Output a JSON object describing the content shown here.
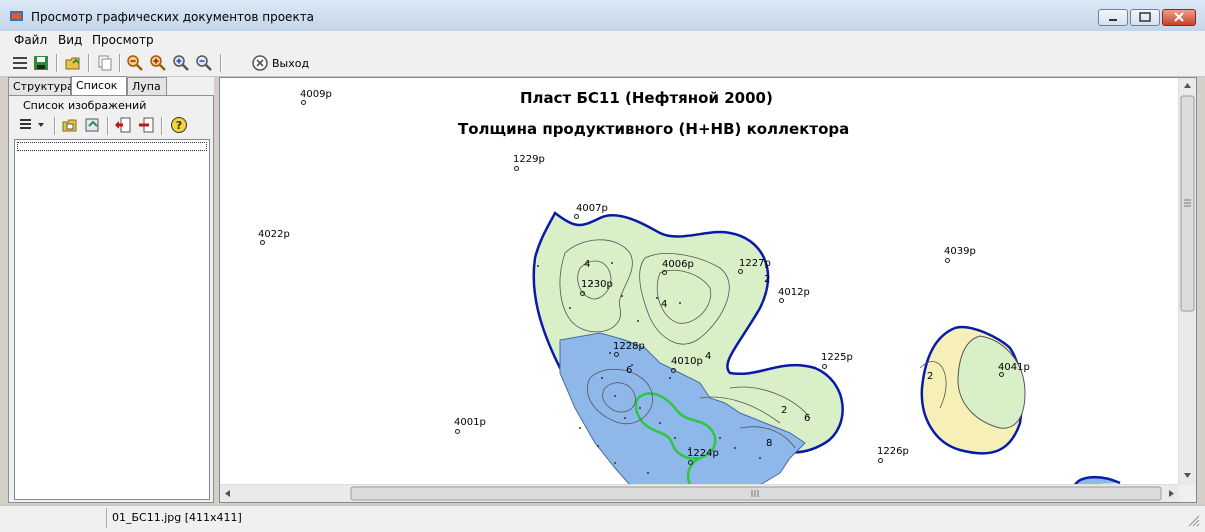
{
  "window": {
    "title": "Просмотр графических документов проекта"
  },
  "menu": {
    "items": [
      "Файл",
      "Вид",
      "Просмотр"
    ]
  },
  "toolbar": {
    "exit_label": "Выход",
    "icons": [
      "list-view-icon",
      "save-icon",
      "open-folder-icon",
      "copy-icon",
      "zoom-in-icon",
      "zoom-out-icon",
      "zoom-plus-icon",
      "zoom-minus-icon",
      "exit-icon"
    ]
  },
  "left_panel": {
    "tabs": [
      "Структура",
      "Список",
      "Лупа"
    ],
    "active_tab": "Список",
    "group_label": "Список изображений"
  },
  "map": {
    "title": "Пласт БС11 (Нефтяной 2000)",
    "subtitle": "Толщина продуктивного (Н+НВ) коллектора",
    "wells": [
      "4009р",
      "1229р",
      "4007р",
      "4022р",
      "4006р",
      "1227р",
      "4039р",
      "1230р",
      "4012р",
      "1228р",
      "4010р",
      "1225р",
      "4041р",
      "4001р",
      "1224р",
      "1226р"
    ],
    "contour_labels": [
      "4",
      "2",
      "4",
      "4",
      "6",
      "2",
      "6",
      "8",
      "2"
    ]
  },
  "status": {
    "file": "01_БС11.jpg  [411x411]"
  },
  "colors": {
    "zone_green": "#d8efc8",
    "zone_blue": "#8fb8ea",
    "zone_yellow": "#f6f0b8",
    "outline": "#0a1aa8",
    "oil_contour": "#2bc840"
  }
}
